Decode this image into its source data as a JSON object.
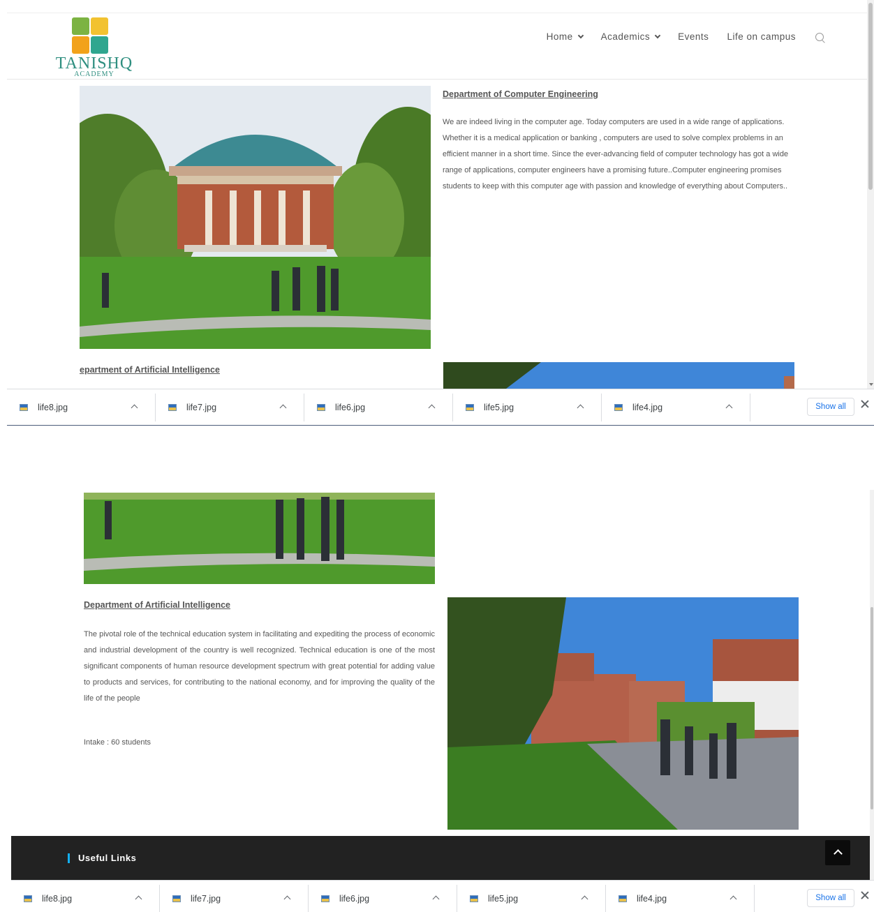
{
  "site": {
    "logo_name": "TANISHQ",
    "logo_sub": "ACADEMY",
    "colors": {
      "logo_teal": "#2f8f80",
      "accent_blue": "#13aff0",
      "footer_bg": "#222222",
      "link_blue": "#1a73e8"
    }
  },
  "nav": {
    "items": [
      {
        "label": "Home",
        "has_dropdown": true
      },
      {
        "label": "Academics",
        "has_dropdown": true
      },
      {
        "label": "Events",
        "has_dropdown": false
      },
      {
        "label": "Life on campus",
        "has_dropdown": false
      }
    ],
    "search_icon": "search-icon"
  },
  "shot1": {
    "dept_ce": {
      "title": "Department of Computer Engineering",
      "text": "We are indeed living in the computer age. Today computers are used in a wide range of applications. Whether it is a medical application or banking , computers are used to solve complex problems in an efficient manner in a short time. Since the ever-advancing field of computer technology has got a wide range of applications, computer engineers have a promising future..Computer engineering promises students to keep with this computer age with passion and knowledge of everything about Computers.."
    },
    "dept_ai_partial_title": "epartment of Artificial Intelligence"
  },
  "shot2": {
    "dept_ai": {
      "title": "Department of Artificial Intelligence",
      "text": "The pivotal role of the technical education system in facilitating and expediting the process of economic and industrial development of the country is well recognized. Technical education is one of the most significant components of human resource development spectrum with great potential for adding value to products and services, for contributing to the national economy, and for improving the quality of the life of the people",
      "intake": "Intake : 60 students"
    },
    "footer": {
      "heading": "Useful Links"
    }
  },
  "downloads": {
    "files": [
      "life8.jpg",
      "life7.jpg",
      "life6.jpg",
      "life5.jpg",
      "life4.jpg"
    ],
    "show_all": "Show all"
  }
}
